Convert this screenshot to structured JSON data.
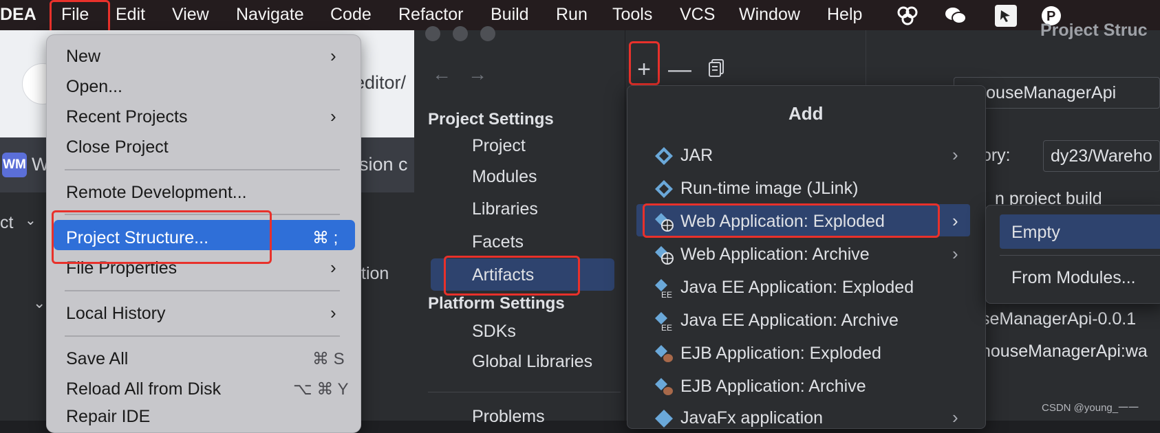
{
  "menubar": {
    "app_name": "DEA",
    "items": [
      "File",
      "Edit",
      "View",
      "Navigate",
      "Code",
      "Refactor",
      "Build",
      "Run",
      "Tools",
      "VCS",
      "Window",
      "Help"
    ],
    "icons": [
      "copilot-icon",
      "wechat-icon",
      "screenshot-icon",
      "paypal-icon"
    ]
  },
  "background": {
    "url_fragment": "editor/",
    "tab_badge": "WM",
    "tab_title_start": "W",
    "tab_title_end": "sion c",
    "ide_left": "ct",
    "ide_right": "tion"
  },
  "file_menu": {
    "items": [
      {
        "label": "New",
        "submenu": true
      },
      {
        "label": "Open...",
        "submenu": false
      },
      {
        "label": "Recent Projects",
        "submenu": true
      },
      {
        "label": "Close Project",
        "submenu": false
      },
      {
        "label": "Remote Development...",
        "submenu": false
      },
      {
        "label": "Project Structure...",
        "shortcut": "⌘ ;",
        "highlighted": true
      },
      {
        "label": "File Properties",
        "submenu": true
      },
      {
        "label": "Local History",
        "submenu": true
      },
      {
        "label": "Save All",
        "shortcut": "⌘ S"
      },
      {
        "label": "Reload All from Disk",
        "shortcut": "⌥ ⌘ Y"
      },
      {
        "label": "Repair IDE",
        "submenu": false
      }
    ]
  },
  "project_structure": {
    "title": "Project Struc",
    "project_settings_header": "Project Settings",
    "project_settings": [
      "Project",
      "Modules",
      "Libraries",
      "Facets",
      "Artifacts"
    ],
    "selected": "Artifacts",
    "platform_settings_header": "Platform Settings",
    "platform_settings": [
      "SDKs",
      "Global Libraries"
    ],
    "problems": "Problems",
    "right_panel": {
      "name_value": "rehouseManagerApi",
      "directory_label": "tory:",
      "directory_value": "dy23/Wareho",
      "build_checkbox": "n project build",
      "row1": "seManagerApi-0.0.1",
      "row2": "houseManagerApi:wa"
    }
  },
  "add_popup": {
    "title": "Add",
    "items": [
      {
        "label": "JAR",
        "submenu": true,
        "icon": "jar-icon"
      },
      {
        "label": "Run-time image (JLink)",
        "submenu": false,
        "icon": "jlink-icon"
      },
      {
        "label": "Web Application: Exploded",
        "submenu": true,
        "icon": "web-exploded-icon",
        "highlighted": true
      },
      {
        "label": "Web Application: Archive",
        "submenu": true,
        "icon": "web-archive-icon"
      },
      {
        "label": "Java EE Application: Exploded",
        "submenu": false,
        "icon": "javaee-exploded-icon"
      },
      {
        "label": "Java EE Application: Archive",
        "submenu": false,
        "icon": "javaee-archive-icon"
      },
      {
        "label": "EJB Application: Exploded",
        "submenu": false,
        "icon": "ejb-exploded-icon"
      },
      {
        "label": "EJB Application: Archive",
        "submenu": false,
        "icon": "ejb-archive-icon"
      },
      {
        "label": "JavaFx application",
        "submenu": true,
        "icon": "javafx-icon"
      }
    ]
  },
  "sub_popup": {
    "items": [
      "Empty",
      "From Modules..."
    ],
    "selected": "Empty"
  },
  "watermark": "CSDN @young_一一",
  "colors": {
    "highlight_red": "#e8312b",
    "selection_blue": "#2e436e",
    "menu_blue": "#2f6fd8",
    "dialog_bg": "#2b2d30"
  }
}
